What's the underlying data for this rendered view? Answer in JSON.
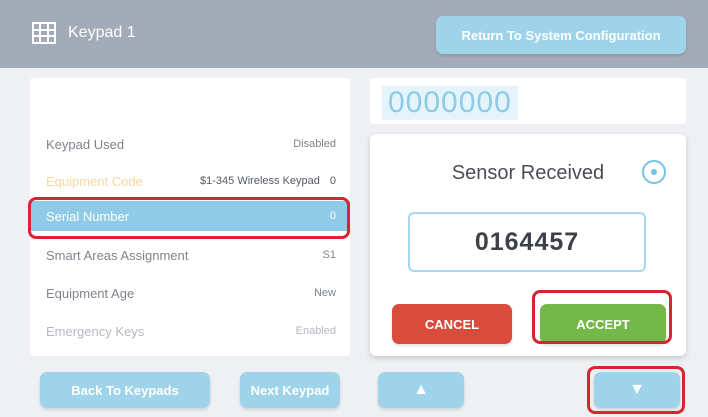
{
  "header": {
    "title": "Keypad 1",
    "return_label": "Return To System Configuration",
    "icon": "keypad-grid-icon"
  },
  "details": {
    "rows": [
      {
        "label": "Keypad Used",
        "value": "Disabled"
      },
      {
        "label": "Equipment Code",
        "value": "$1-345 Wireless Keypad",
        "value_code": "0"
      },
      {
        "label": "Serial Number",
        "value": "0"
      },
      {
        "label": "Smart Areas Assignment",
        "value": "S1"
      },
      {
        "label": "Equipment Age",
        "value": "New"
      },
      {
        "label": "Emergency Keys",
        "value": "Enabled"
      }
    ]
  },
  "display": {
    "number": "0000000"
  },
  "dialog": {
    "title": "Sensor Received",
    "code": "0164457",
    "cancel_label": "CANCEL",
    "accept_label": "ACCEPT",
    "icon": "target-icon"
  },
  "footer": {
    "back_label": "Back To Keypads",
    "next_label": "Next Keypad",
    "up_symbol": "▲",
    "down_symbol": "▼"
  },
  "colors": {
    "header_bg": "#a4abb8",
    "accent_blue": "#9ed3ea",
    "selected_row": "#8fcbe6",
    "cancel_red": "#d94c3c",
    "accept_green": "#74b84a",
    "highlight_red": "#d7262f"
  }
}
